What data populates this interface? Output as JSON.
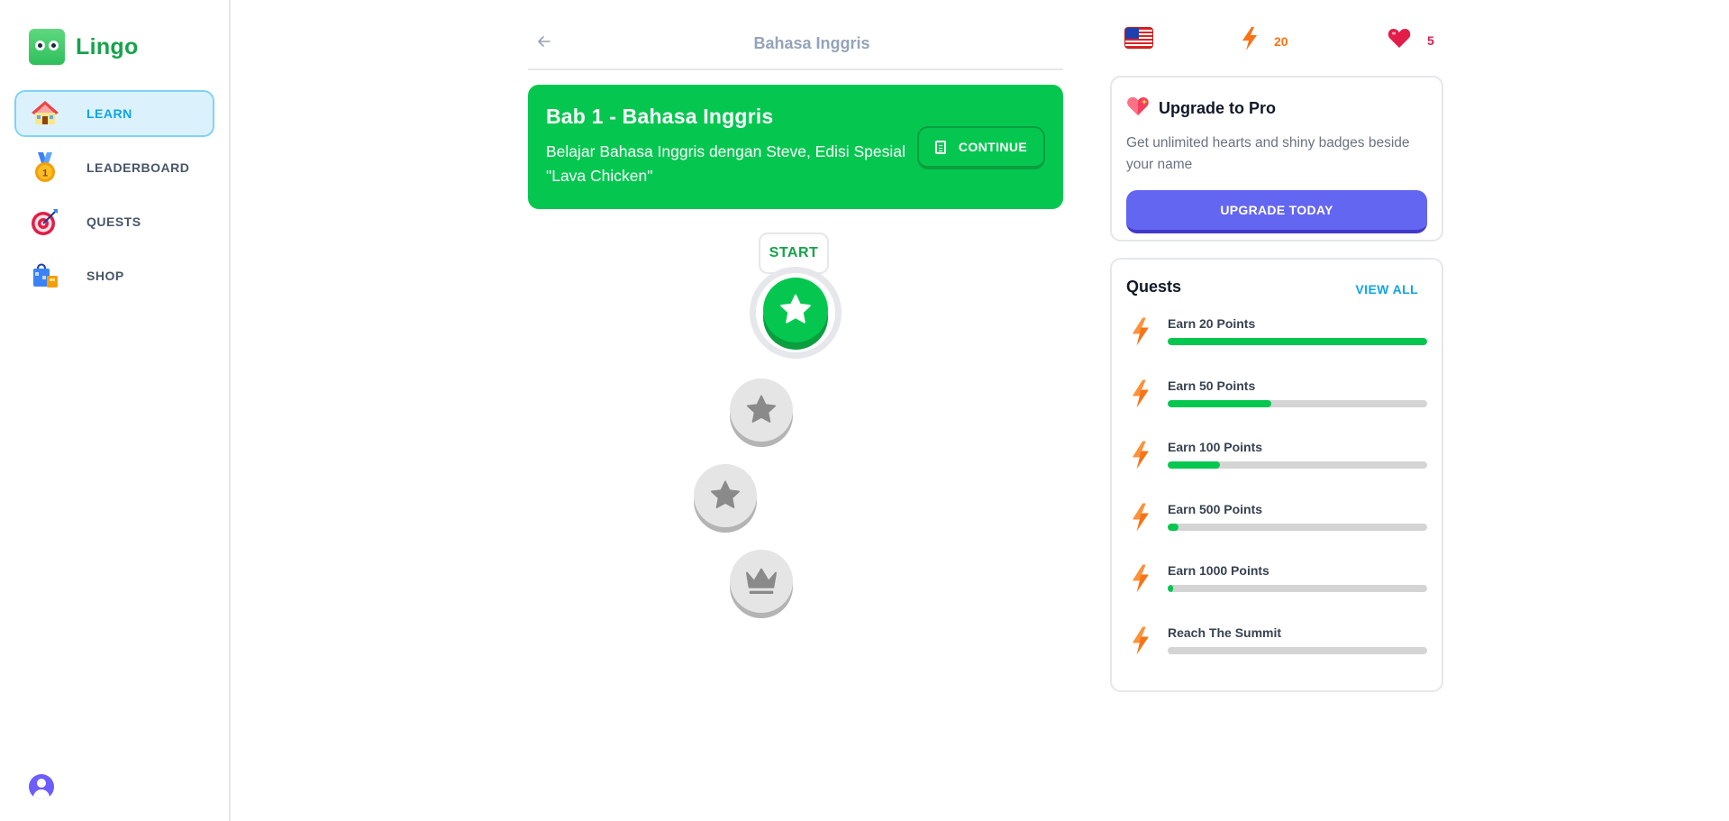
{
  "app": {
    "name": "Lingo"
  },
  "sidebar": {
    "items": [
      {
        "label": "LEARN",
        "icon": "house-icon",
        "active": true
      },
      {
        "label": "LEADERBOARD",
        "icon": "medal-icon",
        "active": false
      },
      {
        "label": "QUESTS",
        "icon": "target-icon",
        "active": false
      },
      {
        "label": "SHOP",
        "icon": "shopping-bag-icon",
        "active": false
      }
    ],
    "medal_number": "1"
  },
  "header": {
    "title": "Bahasa Inggris"
  },
  "unit": {
    "title": "Bab 1 - Bahasa Inggris",
    "description": "Belajar Bahasa Inggris dengan Steve, Edisi Spesial \"Lava Chicken\"",
    "continue_label": "CONTINUE"
  },
  "path": {
    "start_label": "START",
    "lessons": [
      {
        "state": "current",
        "icon": "star-icon"
      },
      {
        "state": "locked",
        "icon": "star-icon"
      },
      {
        "state": "locked",
        "icon": "star-icon"
      },
      {
        "state": "locked",
        "icon": "crown-icon"
      }
    ]
  },
  "stats": {
    "language_flag": "us-flag-icon",
    "points": "20",
    "hearts": "5",
    "points_color": "#f97316",
    "hearts_color": "#e11d48"
  },
  "pro": {
    "title": "Upgrade to Pro",
    "description": "Get unlimited hearts and shiny badges beside your name",
    "button_label": "UPGRADE TODAY"
  },
  "quests": {
    "title": "Quests",
    "view_all_label": "VIEW ALL",
    "items": [
      {
        "label": "Earn 20 Points",
        "progress": 1.0
      },
      {
        "label": "Earn 50 Points",
        "progress": 0.4
      },
      {
        "label": "Earn 100 Points",
        "progress": 0.2
      },
      {
        "label": "Earn 500 Points",
        "progress": 0.04
      },
      {
        "label": "Earn 1000 Points",
        "progress": 0.02
      },
      {
        "label": "Reach The Summit",
        "progress": 0.0
      }
    ]
  },
  "colors": {
    "primary_green": "#05c750",
    "sky": "#0ea5e9",
    "indigo": "#6366f1"
  }
}
